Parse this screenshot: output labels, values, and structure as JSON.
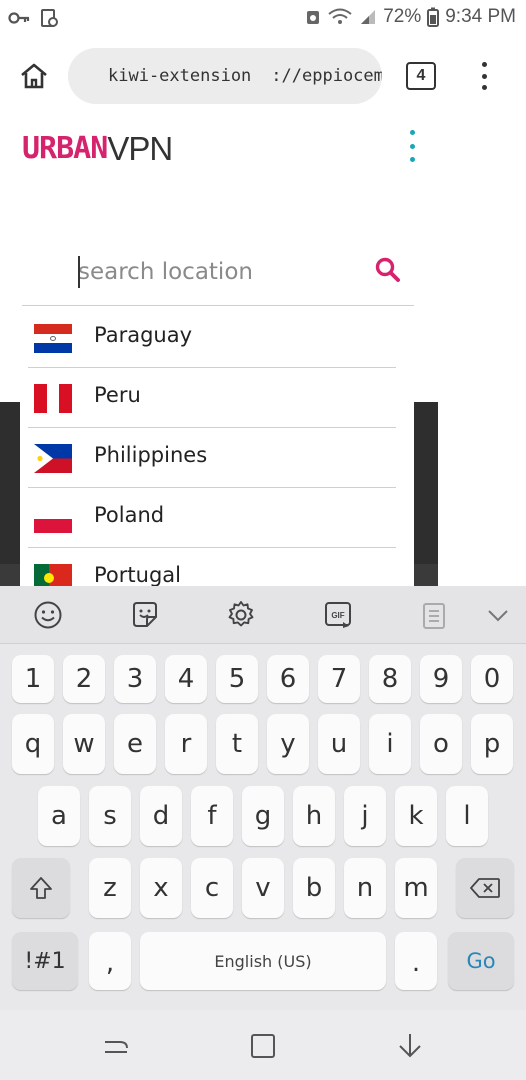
{
  "status": {
    "battery": "72%",
    "time": "9:34 PM"
  },
  "browser": {
    "url_scheme": "kiwi-extension",
    "url_rest": "://eppiocemhmr",
    "tab_count": "4"
  },
  "page": {
    "logo_urban": "URBAN",
    "logo_vpn": "VPN",
    "brand_color": "#d6236e",
    "accent_color": "#1aa6b7",
    "search_placeholder": "search location",
    "countries": [
      {
        "name": "Paraguay",
        "flag": "paraguay-flag"
      },
      {
        "name": "Peru",
        "flag": "peru-flag"
      },
      {
        "name": "Philippines",
        "flag": "philippines-flag"
      },
      {
        "name": "Poland",
        "flag": "poland-flag"
      },
      {
        "name": "Portugal",
        "flag": "portugal-flag"
      }
    ]
  },
  "keyboard": {
    "toolbar": [
      "emoji-icon",
      "sticker-icon",
      "settings-icon",
      "gif-icon",
      "clipboard-icon",
      "chevron-down-icon"
    ],
    "row_numbers": [
      "1",
      "2",
      "3",
      "4",
      "5",
      "6",
      "7",
      "8",
      "9",
      "0"
    ],
    "row_q": [
      "q",
      "w",
      "e",
      "r",
      "t",
      "y",
      "u",
      "i",
      "o",
      "p"
    ],
    "row_a": [
      "a",
      "s",
      "d",
      "f",
      "g",
      "h",
      "j",
      "k",
      "l"
    ],
    "row_z": [
      "z",
      "x",
      "c",
      "v",
      "b",
      "n",
      "m"
    ],
    "symbols_label": "!#1",
    "comma": ",",
    "space_label": "English (US)",
    "period": ".",
    "go_label": "Go"
  }
}
